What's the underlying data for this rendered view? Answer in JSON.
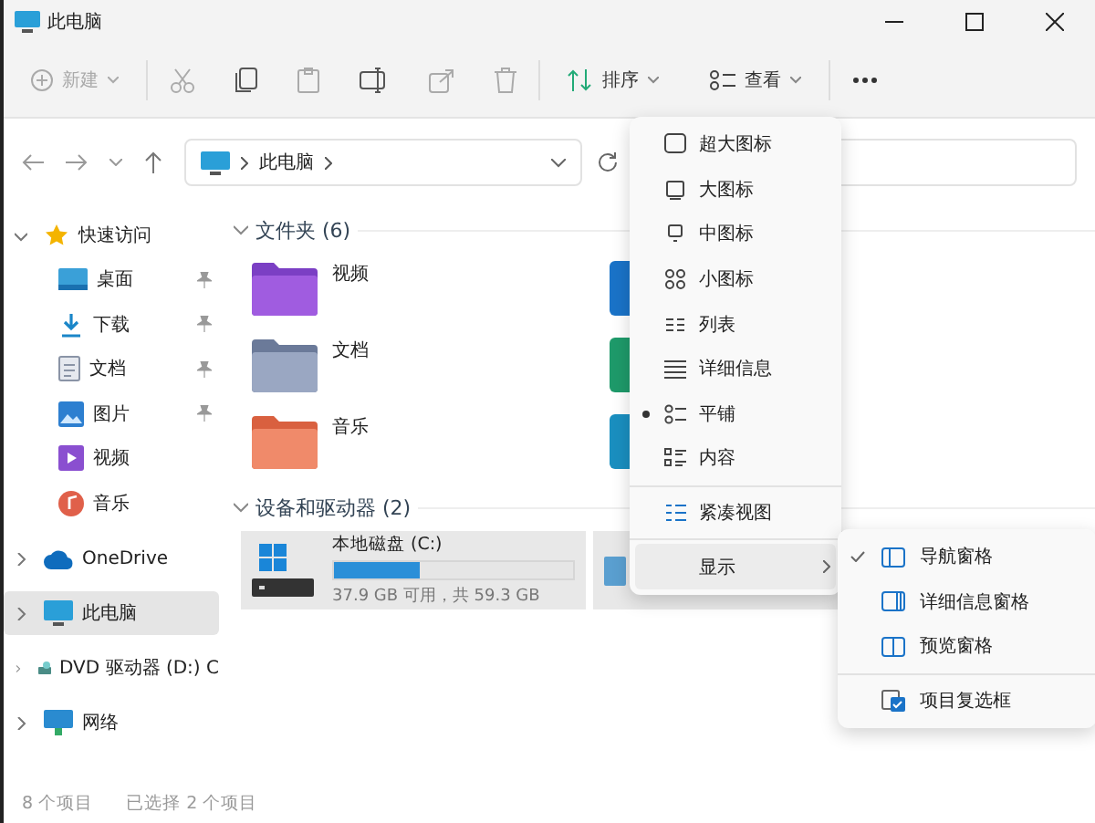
{
  "window": {
    "title": "此电脑"
  },
  "toolbar": {
    "new": {
      "label": "新建",
      "disabled": true
    },
    "sort": {
      "label": "排序"
    },
    "view": {
      "label": "查看"
    }
  },
  "address": {
    "path": [
      "此电脑"
    ]
  },
  "sidebar": {
    "items": [
      {
        "label": "快速访问",
        "expanded": true,
        "selected": false,
        "children": [
          {
            "label": "桌面",
            "pinned": true,
            "selected": false
          },
          {
            "label": "下载",
            "pinned": true,
            "selected": false
          },
          {
            "label": "文档",
            "pinned": true,
            "selected": false
          },
          {
            "label": "图片",
            "pinned": true,
            "selected": false
          },
          {
            "label": "视频",
            "pinned": false,
            "selected": false
          },
          {
            "label": "音乐",
            "pinned": false,
            "selected": false
          }
        ]
      },
      {
        "label": "OneDrive",
        "expanded": false,
        "selected": false
      },
      {
        "label": "此电脑",
        "expanded": false,
        "selected": true
      },
      {
        "label": "DVD 驱动器 (D:) C",
        "expanded": false,
        "selected": false
      },
      {
        "label": "网络",
        "expanded": false,
        "selected": false
      }
    ]
  },
  "content": {
    "folders": {
      "title": "文件夹 (6)",
      "expanded": true,
      "items": [
        {
          "name": "视频"
        },
        {
          "name": "文档"
        },
        {
          "name": "音乐"
        }
      ]
    },
    "drives": {
      "title": "设备和驱动器 (2)",
      "expanded": true,
      "items": [
        {
          "name": "本地磁盘 (C:)",
          "level": 0.36,
          "space": "37.9 GB 可用，共 59.3 GB",
          "selected": true
        }
      ]
    }
  },
  "view_menu": {
    "groups": [
      [
        {
          "kind": "extra-large",
          "label": "超大图标",
          "selected": false
        },
        {
          "kind": "large",
          "label": "大图标",
          "selected": false
        },
        {
          "kind": "medium",
          "label": "中图标",
          "selected": false
        },
        {
          "kind": "small",
          "label": "小图标",
          "selected": false
        },
        {
          "kind": "list",
          "label": "列表",
          "selected": false
        },
        {
          "kind": "details",
          "label": "详细信息",
          "selected": false
        },
        {
          "kind": "tiles",
          "label": "平铺",
          "selected": true
        },
        {
          "kind": "content",
          "label": "内容",
          "selected": false
        }
      ],
      [
        {
          "kind": "compact",
          "label": "紧凑视图",
          "selected": false
        }
      ]
    ],
    "show": {
      "label": "显示",
      "expanded": true,
      "items": [
        {
          "kind": "pane",
          "label": "导航窗格",
          "checked": true
        },
        {
          "kind": "pane",
          "label": "详细信息窗格",
          "checked": false
        },
        {
          "kind": "pane",
          "label": "预览窗格",
          "checked": false
        },
        {
          "kind": "checkbox",
          "label": "项目复选框",
          "checked": false
        }
      ]
    }
  },
  "status_bar": {
    "item_count": "8 个项目",
    "selection": "已选择 2 个项目"
  }
}
